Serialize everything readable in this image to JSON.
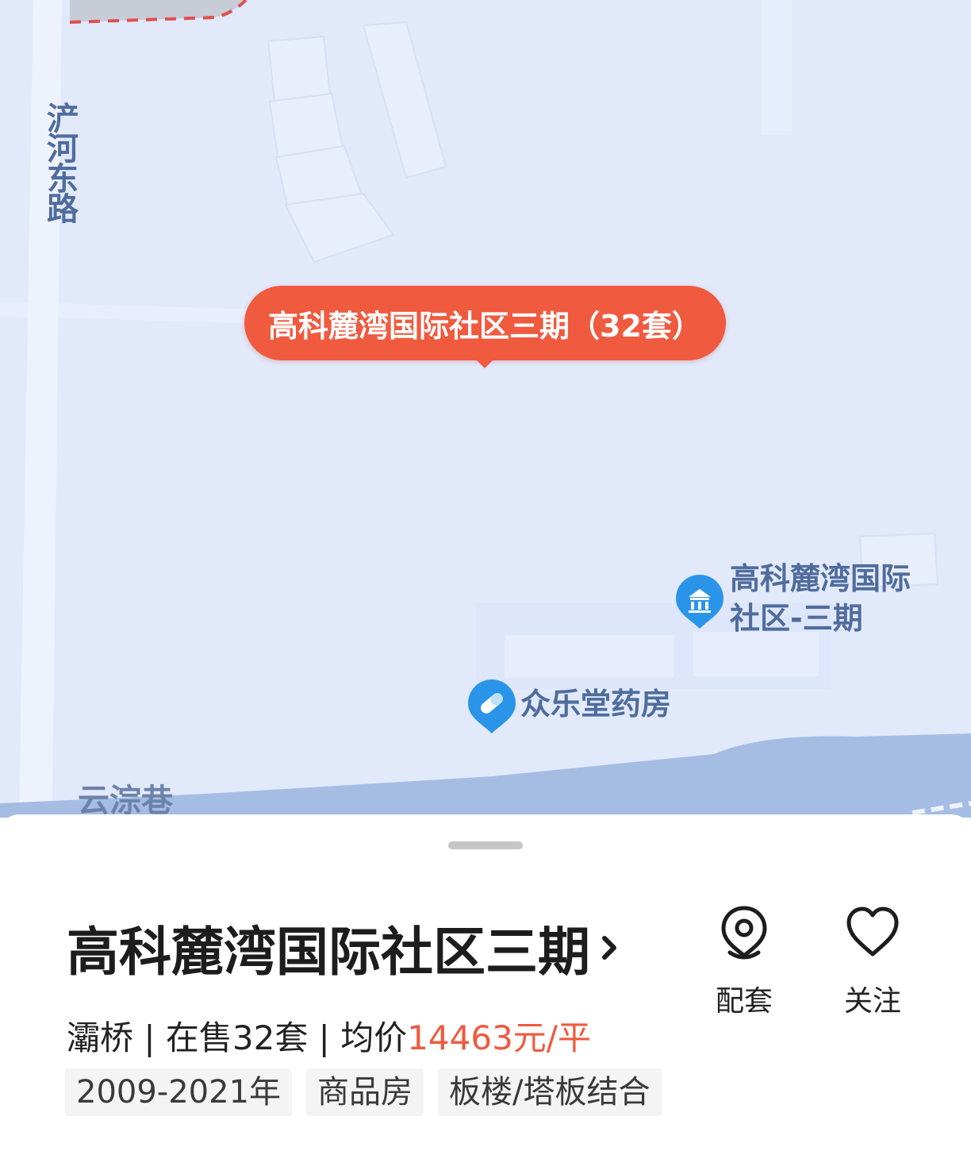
{
  "map": {
    "roads": {
      "vertical_road": "浐河东路",
      "bottom_road": "云淙巷"
    },
    "marker": {
      "label": "高科麓湾国际社区三期（32套）"
    },
    "pois": {
      "community": {
        "line1": "高科麓湾国际",
        "line2": "社区-三期",
        "icon": "building-icon",
        "color": "#2a95e8"
      },
      "pharmacy": {
        "label": "众乐堂药房",
        "icon": "pill-icon",
        "color": "#2a95e8"
      }
    }
  },
  "sheet": {
    "title": "高科麓湾国际社区三期",
    "district": "灞桥",
    "separator": " | ",
    "on_sale": "在售32套",
    "avg_prefix": "均价",
    "avg_price": "14463元/平",
    "tags": [
      "2009-2021年",
      "商品房",
      "板楼/塔板结合"
    ],
    "actions": {
      "amenities": "配套",
      "follow": "关注"
    }
  },
  "colors": {
    "accent": "#f05a3f",
    "map_bg": "#e1e9fb",
    "road_label": "#4f6c9c"
  }
}
